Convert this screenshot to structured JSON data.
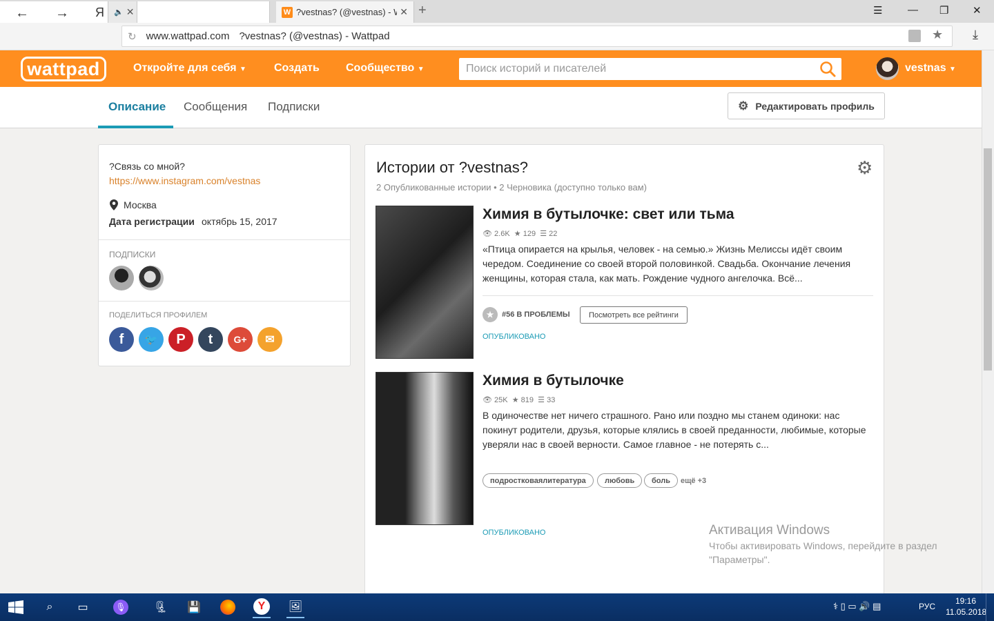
{
  "browser": {
    "tabs": [
      {
        "label": ""
      },
      {
        "label": ""
      },
      {
        "label": "?vestnas? (@vestnas) - W",
        "favicon": "W"
      }
    ],
    "url_domain": "www.wattpad.com",
    "url_title": "?vestnas? (@vestnas) - Wattpad"
  },
  "header": {
    "logo": "wattpad",
    "nav": [
      "Откройте для себя",
      "Создать",
      "Сообщество"
    ],
    "search_placeholder": "Поиск историй и писателей",
    "username": "vestnas"
  },
  "profile_tabs": [
    "Описание",
    "Сообщения",
    "Подписки"
  ],
  "edit_profile_label": "Редактировать профиль",
  "about": {
    "text": "?Связь со мной?",
    "link": "https://www.instagram.com/vestnas",
    "location": "Москва",
    "joined_label": "Дата регистрации",
    "joined_date": "октябрь 15, 2017",
    "following_label": "ПОДПИСКИ",
    "share_label": "ПОДЕЛИТЬСЯ ПРОФИЛЕМ"
  },
  "stories": {
    "title": "Истории от ?vestnas?",
    "subtitle": "2 Опубликованные истории • 2 Черновика (доступно только вам)",
    "items": [
      {
        "title": "Химия в бутылочке: свет или тьма",
        "reads": "2.6K",
        "votes": "129",
        "parts": "22",
        "description": "«Птица опирается на крылья, человек - на семью.» Жизнь Мелиссы идёт своим чередом. Соединение со своей второй половинкой. Свадьба. Окончание лечения женщины, которая стала, как мать. Рождение чудного ангелочка. Всё...",
        "rank": "#56 В ПРОБЛЕМЫ",
        "rank_button": "Посмотреть все рейтинги",
        "status": "ОПУБЛИКОВАНО"
      },
      {
        "title": "Химия в бутылочке",
        "reads": "25K",
        "votes": "819",
        "parts": "33",
        "description": "В одиночестве нет ничего страшного. Рано или поздно мы станем одиноки: нас покинут родители, друзья, которые клялись в своей преданности, любимые, которые уверяли нас в своей верности. Самое главное - не потерять с...",
        "tags": [
          "подростковаялитература",
          "любовь",
          "боль"
        ],
        "more_tags": "ещё +3",
        "status": "ОПУБЛИКОВАНО"
      }
    ]
  },
  "windows_watermark": {
    "title": "Активация Windows",
    "line1": "Чтобы активировать Windows, перейдите в раздел",
    "line2": "\"Параметры\"."
  },
  "taskbar": {
    "lang": "РУС",
    "time": "19:16",
    "date": "11.05.2018"
  },
  "colors": {
    "brand": "#ff8e1f",
    "accent": "#1b9bb5",
    "link": "#d9822b"
  }
}
